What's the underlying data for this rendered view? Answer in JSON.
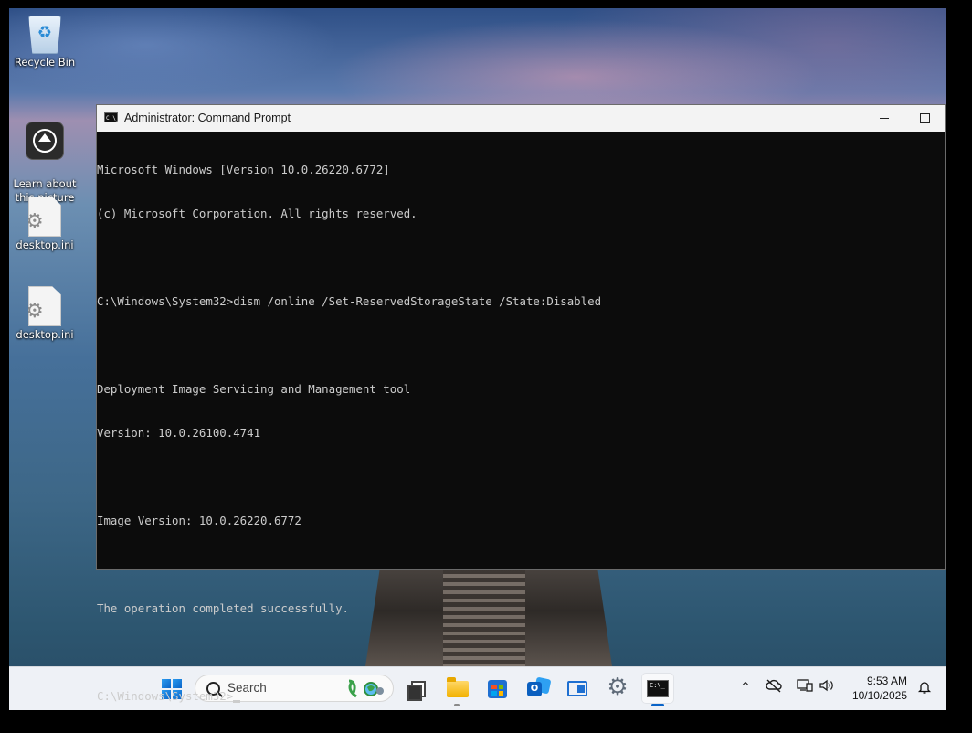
{
  "desktop": {
    "icons": [
      {
        "label": "Recycle Bin",
        "icon": "recycle-bin-icon"
      },
      {
        "label": "Learn about\nthis picture",
        "icon": "learn-about-picture-icon"
      },
      {
        "label": "desktop.ini",
        "icon": "settings-file-icon"
      },
      {
        "label": "desktop.ini",
        "icon": "settings-file-icon"
      }
    ]
  },
  "window": {
    "title": "Administrator: Command Prompt",
    "icon": "command-prompt-icon",
    "icon_text": "C:\\_",
    "minimize_label": "—",
    "maximize_label": "□"
  },
  "console": {
    "lines": [
      "Microsoft Windows [Version 10.0.26220.6772]",
      "(c) Microsoft Corporation. All rights reserved.",
      "",
      "C:\\Windows\\System32>dism /online /Set-ReservedStorageState /State:Disabled",
      "",
      "Deployment Image Servicing and Management tool",
      "Version: 10.0.26100.4741",
      "",
      "Image Version: 10.0.26220.6772",
      "",
      "The operation completed successfully.",
      "",
      "C:\\Windows\\System32>"
    ]
  },
  "taskbar": {
    "search_placeholder": "Search",
    "pinned": [
      {
        "name": "start",
        "icon": "windows-logo-icon"
      },
      {
        "name": "task-view",
        "icon": "task-view-icon"
      },
      {
        "name": "file-explorer",
        "icon": "folder-icon",
        "running": true
      },
      {
        "name": "microsoft-store",
        "icon": "store-icon"
      },
      {
        "name": "outlook",
        "icon": "outlook-icon"
      },
      {
        "name": "app",
        "icon": "window-app-icon"
      },
      {
        "name": "settings",
        "icon": "gear-icon"
      },
      {
        "name": "command-prompt",
        "icon": "command-prompt-icon",
        "active": true
      }
    ],
    "tray": {
      "chevron": "^",
      "icons": [
        "show-hidden-icons-chevron",
        "onedrive-offline-icon",
        "network-icon",
        "volume-icon"
      ]
    },
    "clock": {
      "time": "9:53 AM",
      "date": "10/10/2025"
    },
    "accent": "#0a64c8"
  }
}
